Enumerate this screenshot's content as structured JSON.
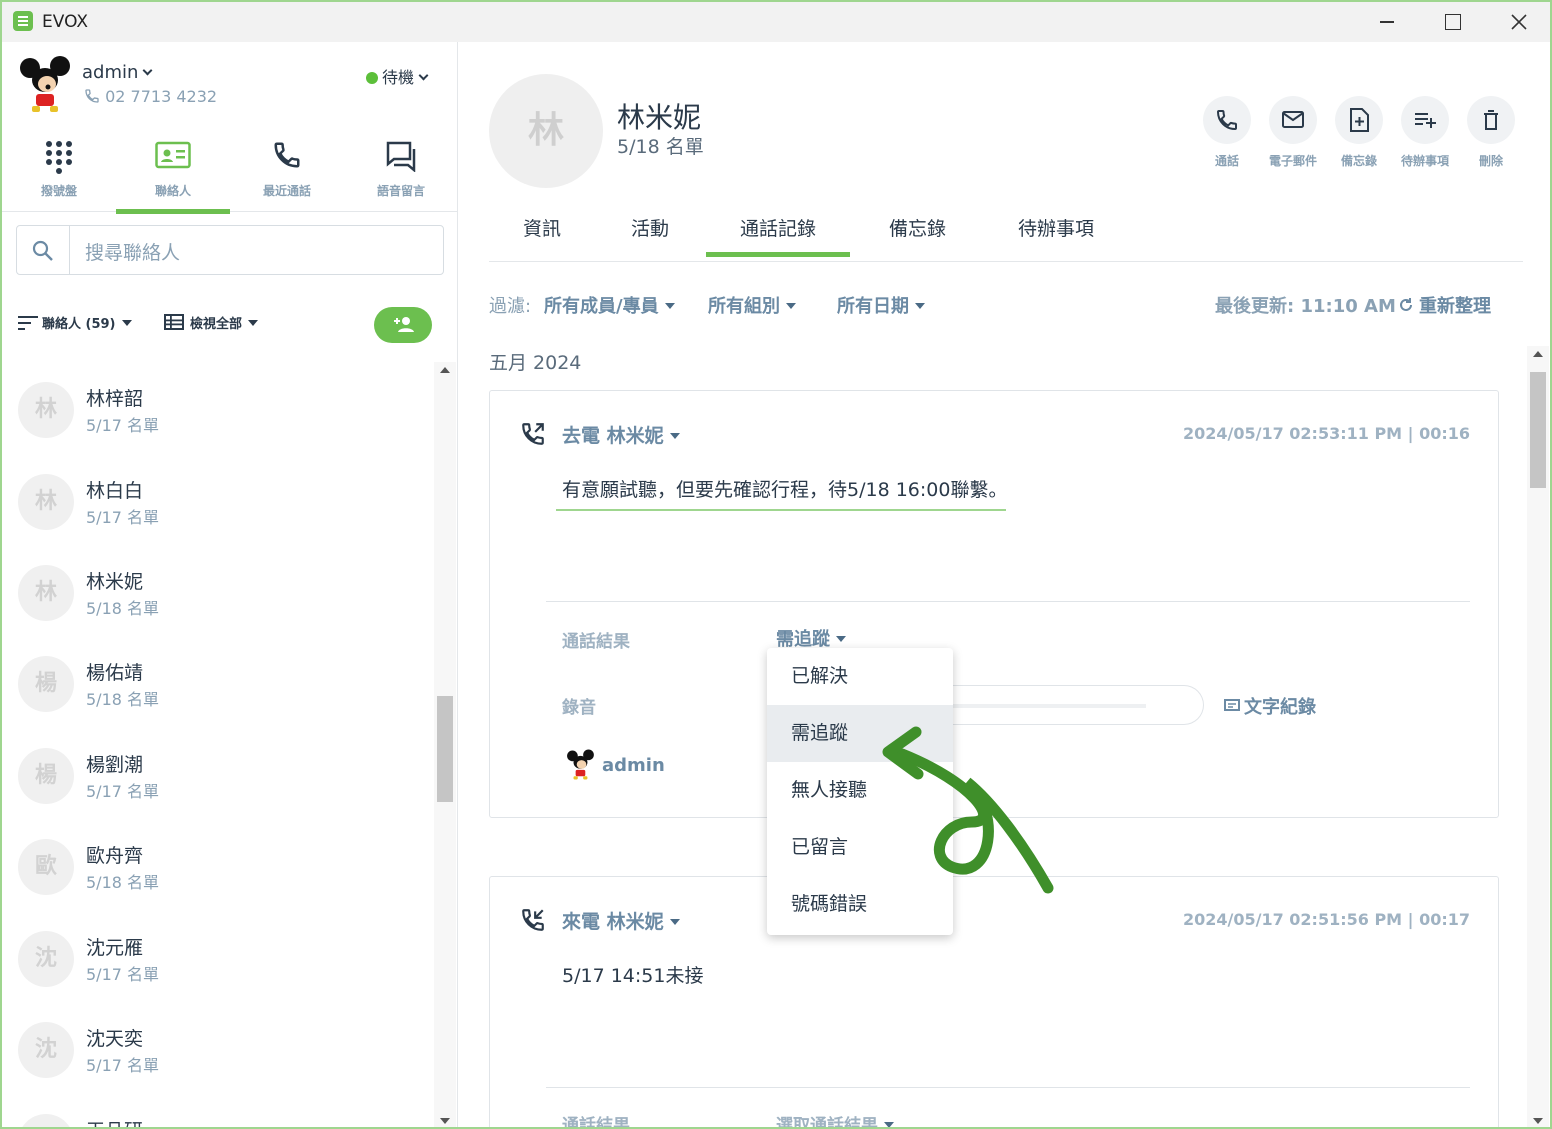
{
  "window": {
    "title": "EVOX"
  },
  "user": {
    "name": "admin",
    "extension": "02 7713 4232",
    "status": "待機",
    "status_color": "#5cbf3a"
  },
  "nav": [
    {
      "label": "撥號盤",
      "icon": "dialpad-icon"
    },
    {
      "label": "聯絡人",
      "icon": "contact-card-icon",
      "active": true
    },
    {
      "label": "最近通話",
      "icon": "phone-icon"
    },
    {
      "label": "語音留言",
      "icon": "voicemail-icon"
    }
  ],
  "search": {
    "placeholder": "搜尋聯絡人"
  },
  "list_tools": {
    "sort_label": "聯絡人 (59)",
    "view_label": "檢視全部"
  },
  "contacts": [
    {
      "initial": "林",
      "name": "林梓韶",
      "list": "5/17 名單"
    },
    {
      "initial": "林",
      "name": "林白白",
      "list": "5/17 名單"
    },
    {
      "initial": "林",
      "name": "林米妮",
      "list": "5/18 名單"
    },
    {
      "initial": "楊",
      "name": "楊佑靖",
      "list": "5/18 名單"
    },
    {
      "initial": "楊",
      "name": "楊劉潮",
      "list": "5/17 名單"
    },
    {
      "initial": "歐",
      "name": "歐舟齊",
      "list": "5/18 名單"
    },
    {
      "initial": "沈",
      "name": "沈元雁",
      "list": "5/17 名單"
    },
    {
      "initial": "沈",
      "name": "沈天奕",
      "list": "5/17 名單"
    },
    {
      "initial": "王",
      "name": "王品研",
      "list": ""
    }
  ],
  "profile": {
    "initial": "林",
    "name": "林米妮",
    "list": "5/18 名單"
  },
  "actions": [
    {
      "label": "通話",
      "icon": "phone-icon"
    },
    {
      "label": "電子郵件",
      "icon": "mail-icon"
    },
    {
      "label": "備忘錄",
      "icon": "note-add-icon"
    },
    {
      "label": "待辦事項",
      "icon": "todo-add-icon"
    },
    {
      "label": "刪除",
      "icon": "trash-icon"
    }
  ],
  "tabs": [
    "資訊",
    "活動",
    "通話記錄",
    "備忘錄",
    "待辦事項"
  ],
  "active_tab": "通話記錄",
  "filter": {
    "label": "過濾:",
    "members": "所有成員/專員",
    "groups": "所有組別",
    "dates": "所有日期",
    "last_updated": "最後更新: 11:10 AM",
    "refresh": "重新整理"
  },
  "month": "五月 2024",
  "calls": [
    {
      "title": "去電 林米妮",
      "time": "2024/05/17 02:53:11 PM | 00:16",
      "note": "有意願試聽，但要先確認行程，待5/18 16:00聯繫。",
      "result_label": "通話結果",
      "result_value": "需追蹤",
      "recording_label": "錄音",
      "transcript": "文字紀錄",
      "agent": "admin"
    },
    {
      "title": "來電 林米妮",
      "time": "2024/05/17 02:51:56 PM | 00:17",
      "note": "5/17 14:51未接",
      "result_label": "通話結果",
      "result_value": "選取通話結果"
    }
  ],
  "result_options": [
    "已解決",
    "需追蹤",
    "無人接聽",
    "已留言",
    "號碼錯誤"
  ],
  "selected_option": "需追蹤",
  "colors": {
    "accent": "#6cbf4f",
    "link": "#6b8aa4",
    "muted": "#8aa1b4"
  }
}
